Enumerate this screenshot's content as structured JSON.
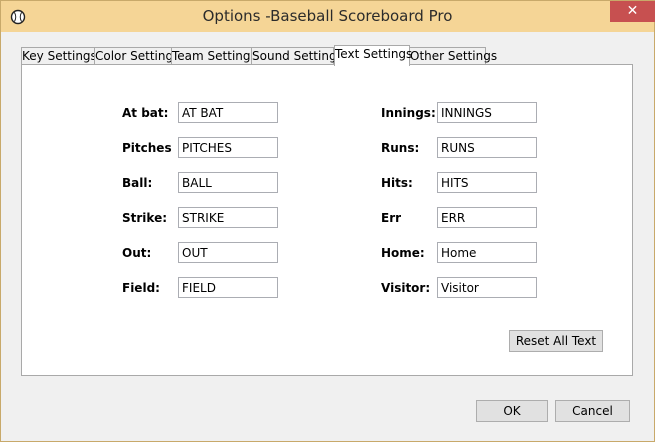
{
  "window": {
    "title": "Options -Baseball Scoreboard Pro",
    "close_glyph": "✕"
  },
  "tabs": [
    {
      "label": "Key Settings"
    },
    {
      "label": "Color Settings"
    },
    {
      "label": "Team Settings"
    },
    {
      "label": "Sound Settings"
    },
    {
      "label": "Text Settings",
      "active": true
    },
    {
      "label": "Other Settings"
    }
  ],
  "text_settings": {
    "left": [
      {
        "label": "At bat:",
        "value": "AT BAT"
      },
      {
        "label": "Pitches",
        "value": "PITCHES"
      },
      {
        "label": "Ball:",
        "value": "BALL"
      },
      {
        "label": "Strike:",
        "value": "STRIKE"
      },
      {
        "label": "Out:",
        "value": "OUT"
      },
      {
        "label": "Field:",
        "value": "FIELD"
      }
    ],
    "right": [
      {
        "label": "Innings:",
        "value": "INNINGS"
      },
      {
        "label": "Runs:",
        "value": "RUNS"
      },
      {
        "label": "Hits:",
        "value": "HITS"
      },
      {
        "label": "Err",
        "value": "ERR"
      },
      {
        "label": "Home:",
        "value": "Home"
      },
      {
        "label": "Visitor:",
        "value": "Visitor"
      }
    ],
    "reset_label": "Reset All Text"
  },
  "footer": {
    "ok_label": "OK",
    "cancel_label": "Cancel"
  },
  "colors": {
    "titlebar": "#f5d596",
    "close": "#c75050"
  }
}
